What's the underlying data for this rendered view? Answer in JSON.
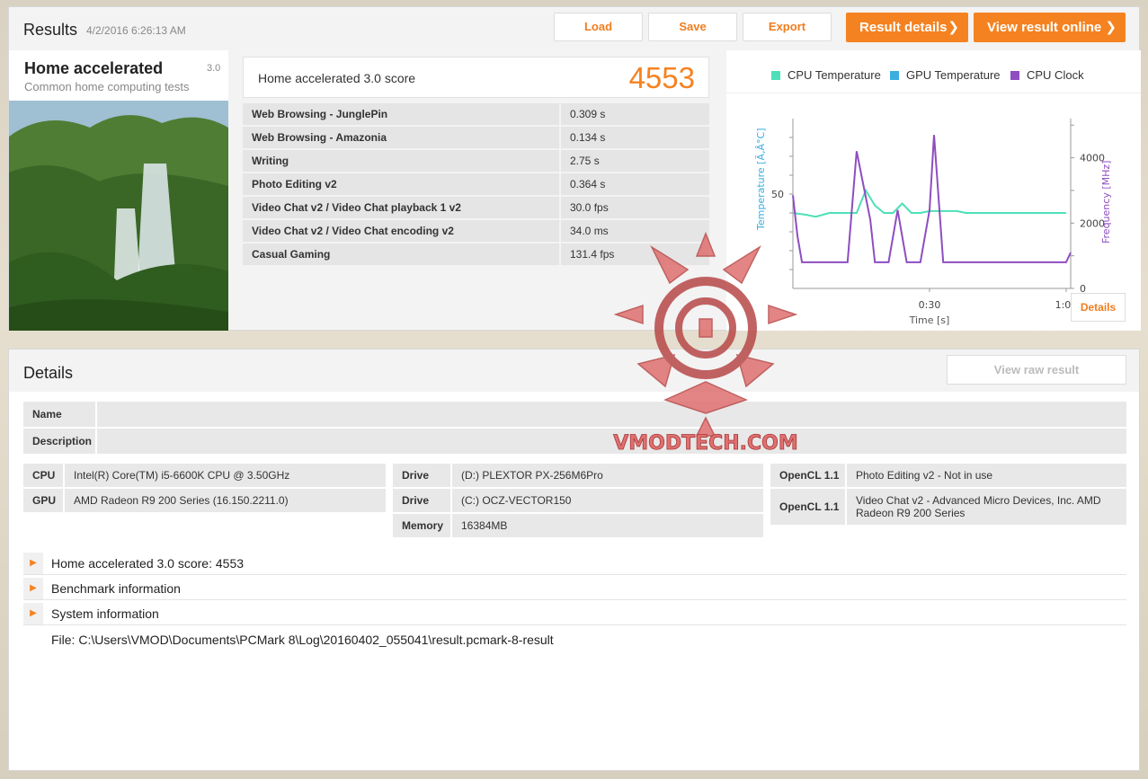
{
  "results": {
    "title": "Results",
    "date": "4/2/2016 6:26:13 AM",
    "buttons": {
      "load": "Load",
      "save": "Save",
      "export": "Export",
      "result_details": "Result details",
      "view_online": "View result online"
    }
  },
  "benchmark": {
    "name": "Home accelerated",
    "version": "3.0",
    "subtitle": "Common home computing tests",
    "score_label": "Home accelerated 3.0 score",
    "score": "4553",
    "subtests": [
      {
        "name": "Web Browsing - JunglePin",
        "value": "0.309 s"
      },
      {
        "name": "Web Browsing - Amazonia",
        "value": "0.134 s"
      },
      {
        "name": "Writing",
        "value": "2.75 s"
      },
      {
        "name": "Photo Editing v2",
        "value": "0.364 s"
      },
      {
        "name": "Video Chat v2 / Video Chat playback 1 v2",
        "value": "30.0 fps"
      },
      {
        "name": "Video Chat v2 / Video Chat encoding v2",
        "value": "34.0 ms"
      },
      {
        "name": "Casual Gaming",
        "value": "131.4 fps"
      }
    ]
  },
  "chart": {
    "details_button": "Details",
    "colors": {
      "cpu_temp": "#4de0b8",
      "gpu_temp": "#3aaee0",
      "cpu_clock": "#8e4dc0"
    }
  },
  "chart_data": {
    "type": "line",
    "series": [
      {
        "name": "CPU Temperature",
        "axis": "left",
        "points": [
          [
            0,
            40
          ],
          [
            3,
            39
          ],
          [
            5,
            38
          ],
          [
            8,
            40
          ],
          [
            12,
            40
          ],
          [
            14,
            40
          ],
          [
            16,
            52
          ],
          [
            18,
            44
          ],
          [
            20,
            40
          ],
          [
            22,
            40
          ],
          [
            24,
            45
          ],
          [
            26,
            40
          ],
          [
            28,
            40
          ],
          [
            30,
            41
          ],
          [
            36,
            41
          ],
          [
            38,
            40
          ],
          [
            60,
            40
          ]
        ]
      },
      {
        "name": "GPU Temperature",
        "axis": "left",
        "points": []
      },
      {
        "name": "CPU Clock",
        "axis": "right",
        "points": [
          [
            0,
            2850
          ],
          [
            1,
            1600
          ],
          [
            2,
            800
          ],
          [
            12,
            800
          ],
          [
            14,
            4200
          ],
          [
            17,
            2100
          ],
          [
            18,
            800
          ],
          [
            21,
            800
          ],
          [
            23,
            2400
          ],
          [
            25,
            800
          ],
          [
            28,
            800
          ],
          [
            30,
            2400
          ],
          [
            31,
            4700
          ],
          [
            33,
            800
          ],
          [
            60,
            800
          ],
          [
            61,
            1100
          ]
        ]
      }
    ],
    "xlabel": "Time [s]",
    "ylabel_left": "Temperature [Ã‚Â°C]",
    "ylabel_right": "Frequency [MHz]",
    "x_ticks": [
      "0:30",
      "1:00"
    ],
    "y_left_ticks": [
      "50"
    ],
    "y_right_ticks": [
      "0",
      "2000",
      "4000"
    ],
    "xlim": [
      0,
      61
    ],
    "ylim_left": [
      0,
      90
    ],
    "ylim_right": [
      0,
      5200
    ],
    "legend": "top"
  },
  "details": {
    "title": "Details",
    "raw_button": "View raw result",
    "name_label": "Name",
    "description_label": "Description",
    "cpu_label": "CPU",
    "cpu": "Intel(R) Core(TM) i5-6600K CPU @ 3.50GHz",
    "gpu_label": "GPU",
    "gpu": "AMD Radeon R9 200 Series (16.150.2211.0)",
    "drive_label": "Drive",
    "drive1": "(D:) PLEXTOR PX-256M6Pro",
    "drive2": "(C:) OCZ-VECTOR150",
    "memory_label": "Memory",
    "memory": "16384MB",
    "opencl_label": "OpenCL 1.1",
    "opencl1": "Photo Editing v2 - Not in use",
    "opencl2": "Video Chat v2 - Advanced Micro Devices, Inc. AMD Radeon R9 200 Series",
    "expanders": [
      "Home accelerated 3.0 score: 4553",
      "Benchmark information",
      "System information"
    ],
    "file": "File: C:\\Users\\VMOD\\Documents\\PCMark 8\\Log\\20160402_055041\\result.pcmark-8-result"
  },
  "watermark": {
    "text": "VMODTECH.COM"
  }
}
